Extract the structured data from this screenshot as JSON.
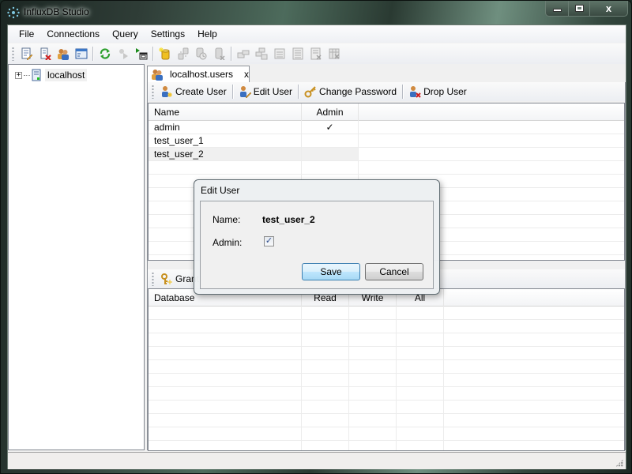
{
  "window": {
    "title": "InfluxDB Studio",
    "caption_close": "x"
  },
  "menu": {
    "items": [
      "File",
      "Connections",
      "Query",
      "Settings",
      "Help"
    ]
  },
  "toolbar": {
    "buttons": [
      "edit-connection-icon",
      "remove-connection-icon",
      "users-icon",
      "console-icon",
      "refresh-icon",
      "run-query-icon-disabled",
      "new-query-window-icon",
      "create-database-icon",
      "copy-database-icon-disabled",
      "retention-policy-icon-disabled",
      "drop-database-icon-disabled",
      "diagnostics-icon-disabled",
      "series-icon-disabled",
      "measurements-icon-disabled",
      "fields-icon-disabled",
      "drop-series-icon-disabled",
      "drop-measurement-icon-disabled"
    ]
  },
  "tree": {
    "nodes": [
      {
        "label": "localhost",
        "expander": "+"
      }
    ]
  },
  "tab": {
    "label": "localhost.users",
    "close": "x"
  },
  "users_toolbar": {
    "create": "Create User",
    "edit": "Edit User",
    "change_password": "Change Password",
    "drop": "Drop User"
  },
  "users_grid": {
    "columns": [
      "Name",
      "Admin"
    ],
    "rows": [
      {
        "name": "admin",
        "admin": "✓"
      },
      {
        "name": "test_user_1",
        "admin": ""
      },
      {
        "name": "test_user_2",
        "admin": ""
      }
    ],
    "selected_row": 2
  },
  "perm_toolbar": {
    "grant": "Grant"
  },
  "perm_grid": {
    "columns": [
      "Database",
      "Read",
      "Write",
      "All"
    ]
  },
  "dialog": {
    "title": "Edit User",
    "name_label": "Name:",
    "name_value": "test_user_2",
    "admin_label": "Admin:",
    "admin_checked": true,
    "check_glyph": "✓",
    "save": "Save",
    "cancel": "Cancel"
  }
}
